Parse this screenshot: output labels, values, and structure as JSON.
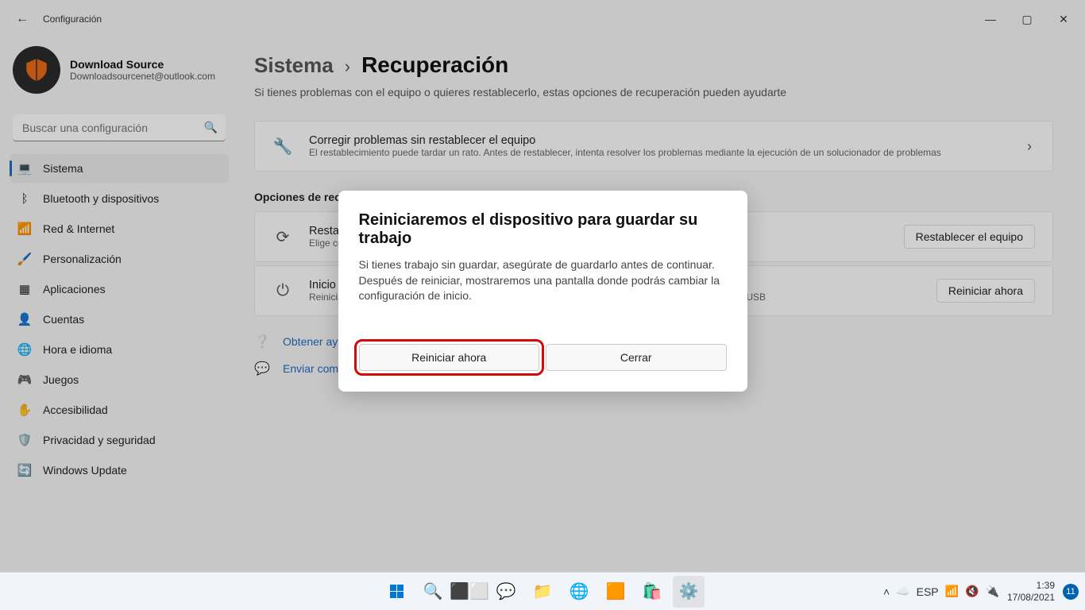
{
  "window": {
    "title": "Configuración"
  },
  "profile": {
    "name": "Download Source",
    "email": "Downloadsourcenet@outlook.com"
  },
  "search": {
    "placeholder": "Buscar una configuración"
  },
  "sidebar": {
    "items": [
      {
        "label": "Sistema",
        "icon": "💻",
        "active": true
      },
      {
        "label": "Bluetooth y dispositivos",
        "icon": "ᛒ"
      },
      {
        "label": "Red & Internet",
        "icon": "📶"
      },
      {
        "label": "Personalización",
        "icon": "🖌️"
      },
      {
        "label": "Aplicaciones",
        "icon": "▦"
      },
      {
        "label": "Cuentas",
        "icon": "👤"
      },
      {
        "label": "Hora e idioma",
        "icon": "🌐"
      },
      {
        "label": "Juegos",
        "icon": "🎮"
      },
      {
        "label": "Accesibilidad",
        "icon": "✋"
      },
      {
        "label": "Privacidad y seguridad",
        "icon": "🛡️"
      },
      {
        "label": "Windows Update",
        "icon": "🔄"
      }
    ]
  },
  "breadcrumb": {
    "parent": "Sistema",
    "sep": "›",
    "page": "Recuperación"
  },
  "lead": "Si tienes problemas con el equipo o quieres restablecerlo, estas opciones de recuperación pueden ayudarte",
  "card_fix": {
    "title": "Corregir problemas sin restablecer el equipo",
    "sub": "El restablecimiento puede tardar un rato. Antes de restablecer, intenta resolver los problemas mediante la ejecución de un solucionador de problemas",
    "chevron": "›"
  },
  "section_h": "Opciones de recuperación",
  "card_reset": {
    "title": "Restablecer este equipo",
    "sub": "Elige conservar o quitar tus archivos y, a continuación, reinstala Windows",
    "button": "Restablecer el equipo"
  },
  "card_startup": {
    "title": "Inicio avanzado",
    "sub": "Reinicia el dispositivo para cambiar la configuración de inicio, incluido el inicio desde un disco o unidad USB",
    "button": "Reiniciar ahora"
  },
  "links": {
    "help": "Obtener ayuda",
    "feedback": "Enviar comentarios"
  },
  "modal": {
    "title": "Reiniciaremos el dispositivo para guardar su trabajo",
    "text": "Si tienes trabajo sin guardar, asegúrate de guardarlo antes de continuar. Después de reiniciar, mostraremos una pantalla donde podrás cambiar la configuración de inicio.",
    "primary": "Reiniciar ahora",
    "secondary": "Cerrar"
  },
  "taskbar": {
    "lang": "ESP",
    "time": "1:39",
    "date": "17/08/2021",
    "notif": "11"
  }
}
